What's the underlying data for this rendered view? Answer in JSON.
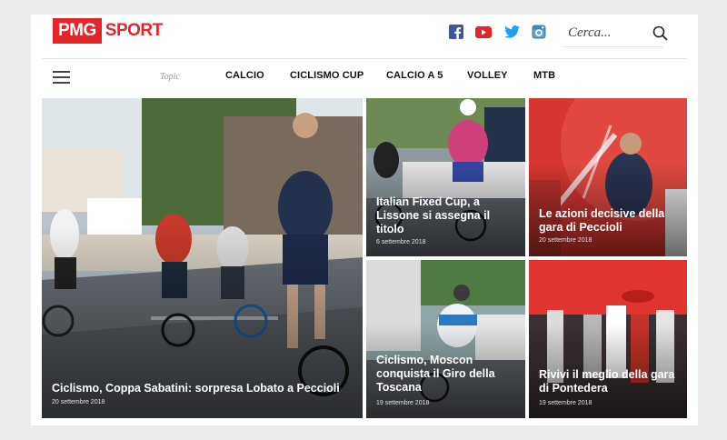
{
  "brand": {
    "logo_box": "PMG",
    "logo_text": "SPORT",
    "color": "#e4262b"
  },
  "social": [
    {
      "name": "facebook-icon",
      "color": "#3b5998"
    },
    {
      "name": "youtube-icon",
      "color": "#e4262b"
    },
    {
      "name": "twitter-icon",
      "color": "#1da1f2"
    },
    {
      "name": "instagram-icon",
      "color": "#3f86b8"
    }
  ],
  "search": {
    "placeholder": "Cerca..."
  },
  "nav": {
    "topic_label": "Topic",
    "items": [
      "CALCIO",
      "CICLISMO CUP",
      "CALCIO A 5",
      "VOLLEY",
      "MTB"
    ]
  },
  "articles": [
    {
      "title": "Ciclismo, Coppa Sabatini: sorpresa Lobato a Peccioli",
      "date": "20 settembre 2018"
    },
    {
      "title": "Italian Fixed Cup, a Lissone si assegna il titolo",
      "date": "6 settembre 2018"
    },
    {
      "title": "Le azioni decisive della gara di Peccioli",
      "date": "20 settembre 2018"
    },
    {
      "title": "Ciclismo, Moscon conquista il Giro della Toscana",
      "date": "19 settembre 2018"
    },
    {
      "title": "Rivivi il meglio della gara di Pontedera",
      "date": "19 settembre 2018"
    }
  ]
}
